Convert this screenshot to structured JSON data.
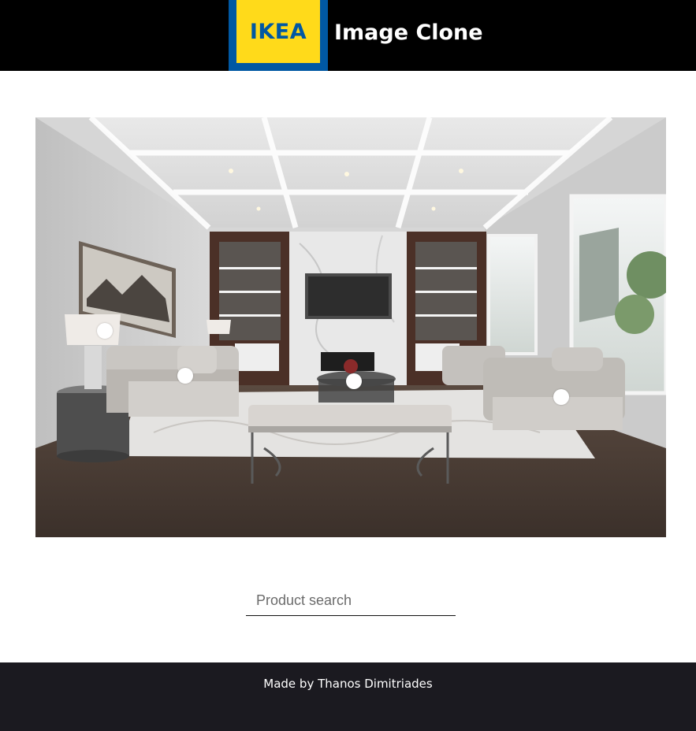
{
  "header": {
    "logo_text": "IKEA",
    "title": "Image Clone",
    "colors": {
      "bar": "#000000",
      "logo_blue": "#0058a3",
      "logo_yellow": "#ffda1a"
    }
  },
  "room_image": {
    "icon": "living-room-photo",
    "hotspots": [
      {
        "name": "lamp"
      },
      {
        "name": "sofa"
      },
      {
        "name": "coffee-table"
      },
      {
        "name": "armchair"
      }
    ]
  },
  "search": {
    "placeholder": "Product search",
    "value": ""
  },
  "footer": {
    "text": "Made by Thanos Dimitriades",
    "color": "#1b1a20"
  }
}
